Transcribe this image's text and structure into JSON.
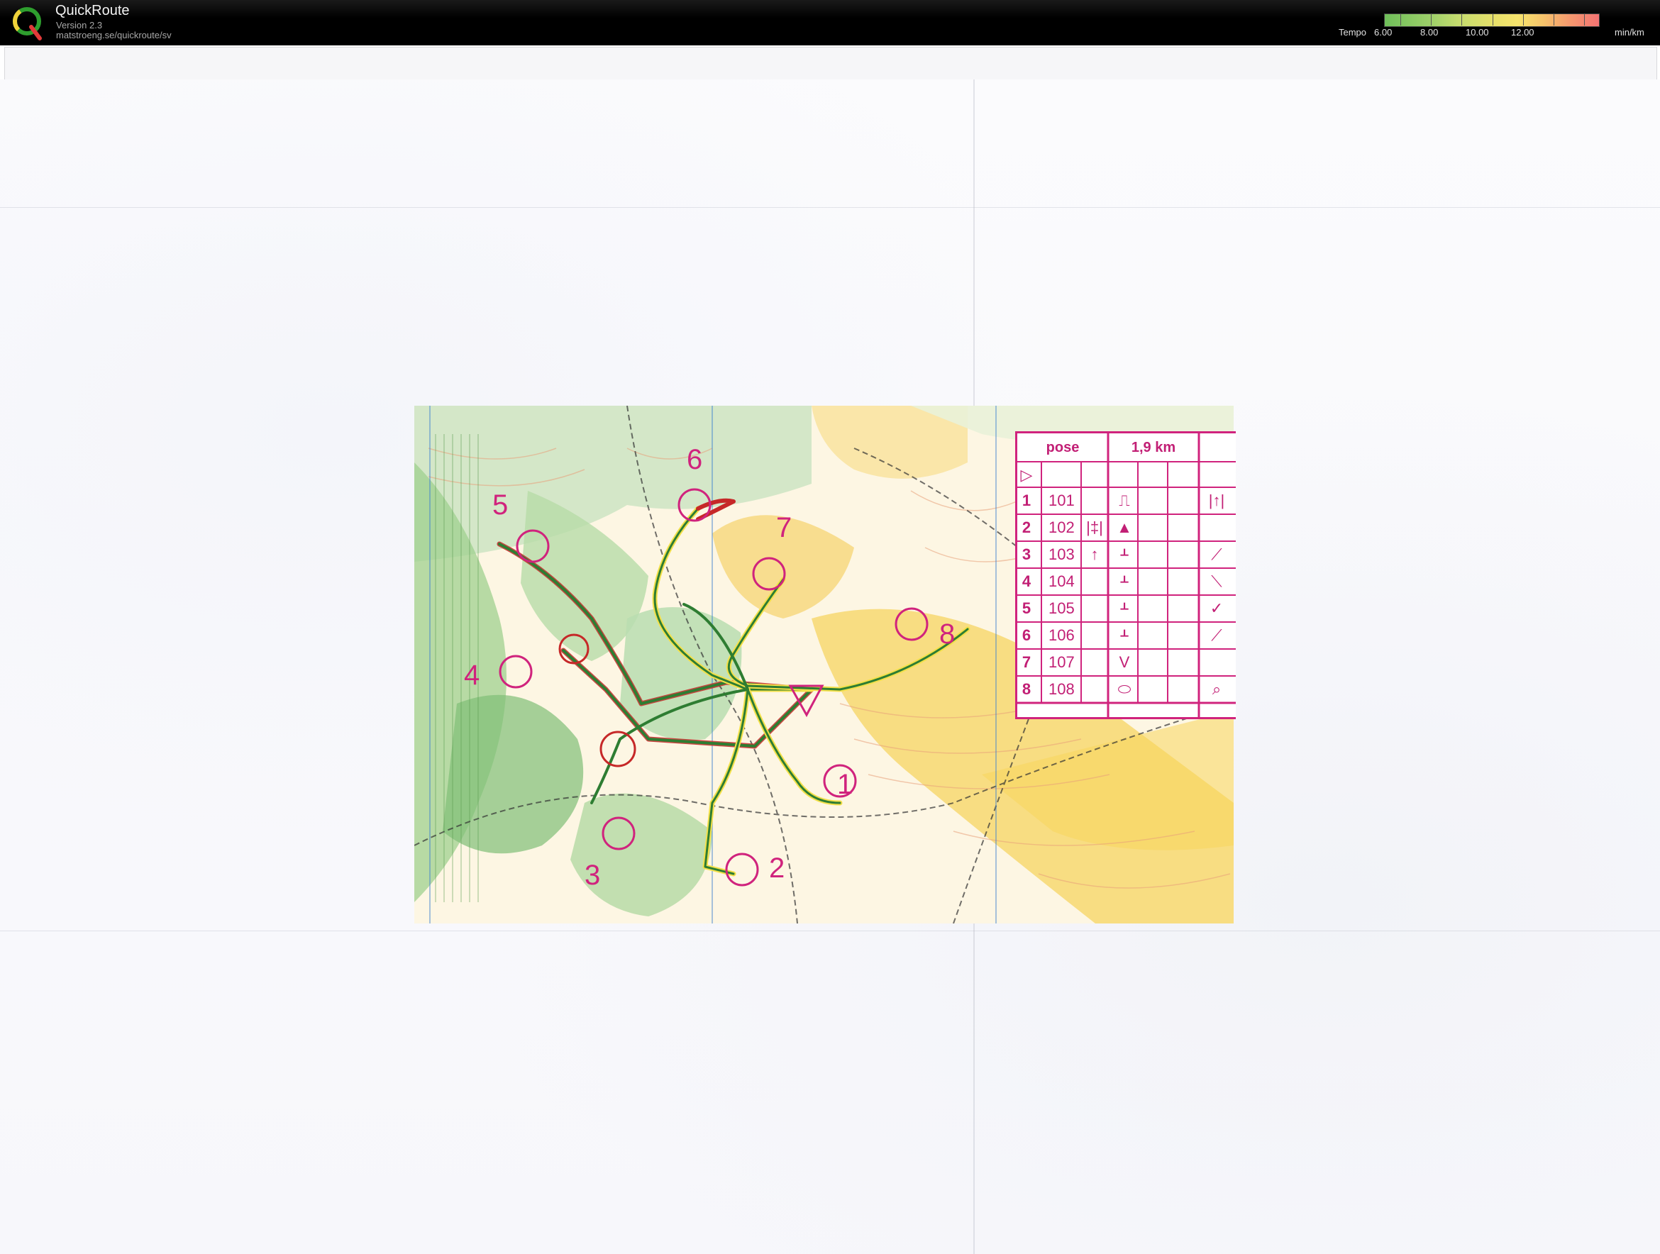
{
  "app": {
    "title": "QuickRoute",
    "version": "Version 2.3",
    "url": "matstroeng.se/quickroute/sv"
  },
  "legend": {
    "label": "Tempo",
    "values": [
      "6.00",
      "8.00",
      "10.00",
      "12.00"
    ],
    "unit": "min/km",
    "colors": [
      "#6fbf5a",
      "#c9dd6e",
      "#f6e46d",
      "#f6c36b",
      "#f47373"
    ]
  },
  "map": {
    "controls": [
      {
        "label": "1"
      },
      {
        "label": "2"
      },
      {
        "label": "3"
      },
      {
        "label": "4"
      },
      {
        "label": "5"
      },
      {
        "label": "6"
      },
      {
        "label": "7"
      },
      {
        "label": "8"
      }
    ],
    "colors": {
      "overprint": "#d0237d",
      "route_green": "#2e7d32",
      "route_yellow": "#f3e04a",
      "route_red": "#c62828"
    }
  },
  "control_description": {
    "event": "pose",
    "distance": "1,9 km",
    "start_symbol": "▷",
    "rows": [
      {
        "num": "1",
        "code": "101",
        "feature": "⎍",
        "extra": "",
        "detail": "|↑|"
      },
      {
        "num": "2",
        "code": "102",
        "feature": "▲",
        "extra": "|‡|",
        "detail": ""
      },
      {
        "num": "3",
        "code": "103",
        "feature": "ᚆ",
        "extra": "↑",
        "detail": "⟋"
      },
      {
        "num": "4",
        "code": "104",
        "feature": "ᚆ",
        "extra": "",
        "detail": "⟍"
      },
      {
        "num": "5",
        "code": "105",
        "feature": "ᚆ",
        "extra": "",
        "detail": "✓"
      },
      {
        "num": "6",
        "code": "106",
        "feature": "ᚆ",
        "extra": "",
        "detail": "⟋"
      },
      {
        "num": "7",
        "code": "107",
        "feature": "V",
        "extra": "",
        "detail": ""
      },
      {
        "num": "8",
        "code": "108",
        "feature": "⬭",
        "extra": "",
        "detail": "⌕"
      }
    ]
  }
}
